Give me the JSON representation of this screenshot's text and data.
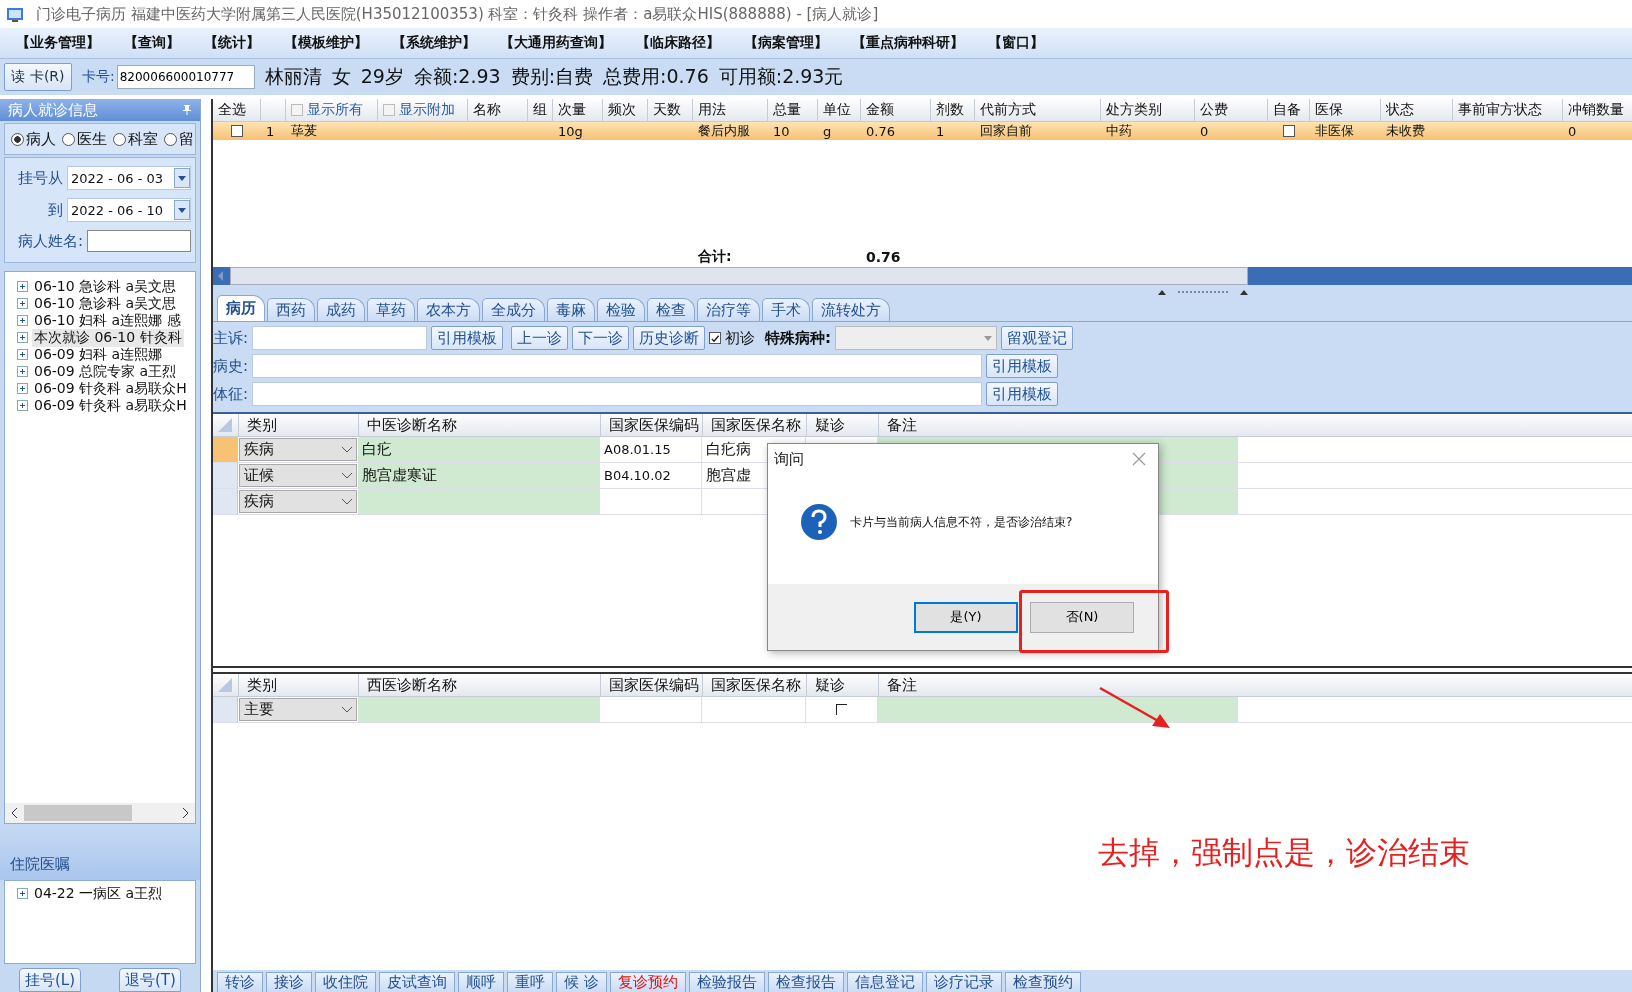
{
  "window": {
    "title": "门诊电子病历  福建中医药大学附属第三人民医院(H35012100353)  科室：针灸科  操作者：a易联众HIS(888888) - [病人就诊]"
  },
  "menu": [
    "【业务管理】",
    "【查询】",
    "【统计】",
    "【模板维护】",
    "【系统维护】",
    "【大通用药查询】",
    "【临床路径】",
    "【病案管理】",
    "【重点病种科研】",
    "【窗口】"
  ],
  "card_bar": {
    "read_button": "读 卡(R)",
    "card_label": "卡号:",
    "card_number": "820006600010777",
    "patient_info": [
      "林丽清",
      "女",
      "29岁",
      "余额:2.93",
      "费别:自费",
      "总费用:0.76",
      "可用额:2.93元"
    ]
  },
  "patient_panel": {
    "title": "病人就诊信息",
    "filters": [
      {
        "label": "病人",
        "selected": true
      },
      {
        "label": "医生",
        "selected": false
      },
      {
        "label": "科室",
        "selected": false
      },
      {
        "label": "留",
        "selected": false
      }
    ],
    "date_from_label": "挂号从",
    "date_from": "2022 - 06 - 03",
    "date_to_label": "到",
    "date_to": "2022 - 06 - 10",
    "name_label": "病人姓名:",
    "visits": [
      {
        "text": "06-10 急诊科 a吴文思",
        "selected": false
      },
      {
        "text": "06-10 急诊科 a吴文思",
        "selected": false
      },
      {
        "text": "06-10 妇科 a连熙娜 感",
        "selected": false
      },
      {
        "text": "本次就诊 06-10 针灸科",
        "selected": true
      },
      {
        "text": "06-09 妇科 a连熙娜",
        "selected": false
      },
      {
        "text": "06-09 总院专家 a王烈",
        "selected": false
      },
      {
        "text": "06-09 针灸科 a易联众H",
        "selected": false
      },
      {
        "text": "06-09 针灸科 a易联众H",
        "selected": false
      }
    ],
    "inpatient_title": "住院医嘱",
    "inpatient_orders": [
      "04-22 一病区 a王烈"
    ],
    "buttons": [
      "挂号(L)",
      "退号(T)"
    ]
  },
  "prescription_grid": {
    "columns": [
      {
        "kind": "text",
        "label": "全选"
      },
      null,
      {
        "kind": "checkbox",
        "label": "显示所有",
        "checked": false
      },
      {
        "kind": "checkbox",
        "label": "显示附加",
        "checked": false
      },
      {
        "kind": "text",
        "label": "名称"
      },
      {
        "kind": "text",
        "label": "组"
      },
      {
        "kind": "text",
        "label": "次量"
      },
      {
        "kind": "text",
        "label": "频次"
      },
      {
        "kind": "text",
        "label": "天数"
      },
      {
        "kind": "text",
        "label": "用法"
      },
      {
        "kind": "text",
        "label": "总量"
      },
      {
        "kind": "text",
        "label": "单位"
      },
      {
        "kind": "text",
        "label": "金额"
      },
      {
        "kind": "text",
        "label": "剂数"
      },
      {
        "kind": "text",
        "label": "代前方式"
      },
      {
        "kind": "text",
        "label": "处方类别"
      },
      {
        "kind": "text",
        "label": "公费"
      },
      {
        "kind": "text",
        "label": "自备"
      },
      {
        "kind": "text",
        "label": "医保"
      },
      {
        "kind": "text",
        "label": "状态"
      },
      {
        "kind": "text",
        "label": "事前审方状态"
      },
      {
        "kind": "text",
        "label": "冲销数量"
      }
    ],
    "rows": [
      {
        "selected": true,
        "cells": [
          {
            "kind": "checkbox",
            "checked": false
          },
          "1",
          "荜茇",
          null,
          null,
          null,
          "10g",
          null,
          null,
          "餐后内服",
          "10",
          "g",
          "0.76",
          "1",
          "回家自前",
          "中药",
          "0",
          {
            "kind": "checkbox",
            "checked": false
          },
          "非医保",
          "未收费",
          null,
          "0"
        ]
      }
    ],
    "total_label": "合计:",
    "total_value": "0.76"
  },
  "tabs": [
    {
      "label": "病历",
      "selected": true
    },
    {
      "label": "西药",
      "selected": false
    },
    {
      "label": "成药",
      "selected": false
    },
    {
      "label": "草药",
      "selected": false
    },
    {
      "label": "农本方",
      "selected": false
    },
    {
      "label": "全成分",
      "selected": false
    },
    {
      "label": "毒麻",
      "selected": false
    },
    {
      "label": "检验",
      "selected": false
    },
    {
      "label": "检查",
      "selected": false
    },
    {
      "label": "治疗等",
      "selected": false
    },
    {
      "label": "手术",
      "selected": false
    },
    {
      "label": "流转处方",
      "selected": false
    }
  ],
  "record_form": {
    "complaint_label": "主诉:",
    "history_label": "病史:",
    "exam_label": "体征:",
    "template_buttons": [
      "引用模板",
      "引用模板",
      "引用模板"
    ],
    "prev_button": "上一诊",
    "next_button": "下一诊",
    "history_button": "历史诊断",
    "first_visit": {
      "label": "初诊",
      "checked": true
    },
    "special_label": "特殊病种:",
    "observe_button": "留观登记"
  },
  "tcm_diagnosis": {
    "columns": [
      "类别",
      "中医诊断名称",
      "国家医保编码",
      "国家医保名称",
      "疑诊",
      "备注"
    ],
    "rows": [
      {
        "selected": true,
        "category": "疾病",
        "name": "白疕",
        "code": "A08.01.15",
        "insurance_name": "白疕病"
      },
      {
        "selected": false,
        "category": "证候",
        "name": "胞宫虚寒证",
        "code": "B04.10.02",
        "insurance_name": "胞宫虚"
      },
      {
        "selected": false,
        "category": "疾病"
      }
    ]
  },
  "western_diagnosis": {
    "columns": [
      "类别",
      "西医诊断名称",
      "国家医保编码",
      "国家医保名称",
      "疑诊",
      "备注"
    ],
    "rows": [
      {
        "selected": false,
        "category": "主要",
        "suspected": false
      }
    ]
  },
  "action_buttons": [
    {
      "label": "转诊",
      "highlighted": false
    },
    {
      "label": "接诊",
      "highlighted": false
    },
    {
      "label": "收住院",
      "highlighted": false
    },
    {
      "label": "皮试查询",
      "highlighted": false
    },
    {
      "label": "顺呼",
      "highlighted": false
    },
    {
      "label": "重呼",
      "highlighted": false
    },
    {
      "label": "候 诊",
      "highlighted": false
    },
    {
      "label": "复诊预约",
      "highlighted": true
    },
    {
      "label": "检验报告",
      "highlighted": false
    },
    {
      "label": "检查报告",
      "highlighted": false
    },
    {
      "label": "信息登记",
      "highlighted": false
    },
    {
      "label": "诊疗记录",
      "highlighted": false
    },
    {
      "label": "检查预约",
      "highlighted": false
    }
  ],
  "dialog": {
    "title": "询问",
    "message": "卡片与当前病人信息不符，是否诊治结束?",
    "buttons": [
      {
        "label": "是(Y)",
        "default": true,
        "marked": false
      },
      {
        "label": "否(N)",
        "default": false,
        "marked": true
      }
    ]
  },
  "annotation": {
    "text": "去掉，强制点是，诊治结束"
  }
}
